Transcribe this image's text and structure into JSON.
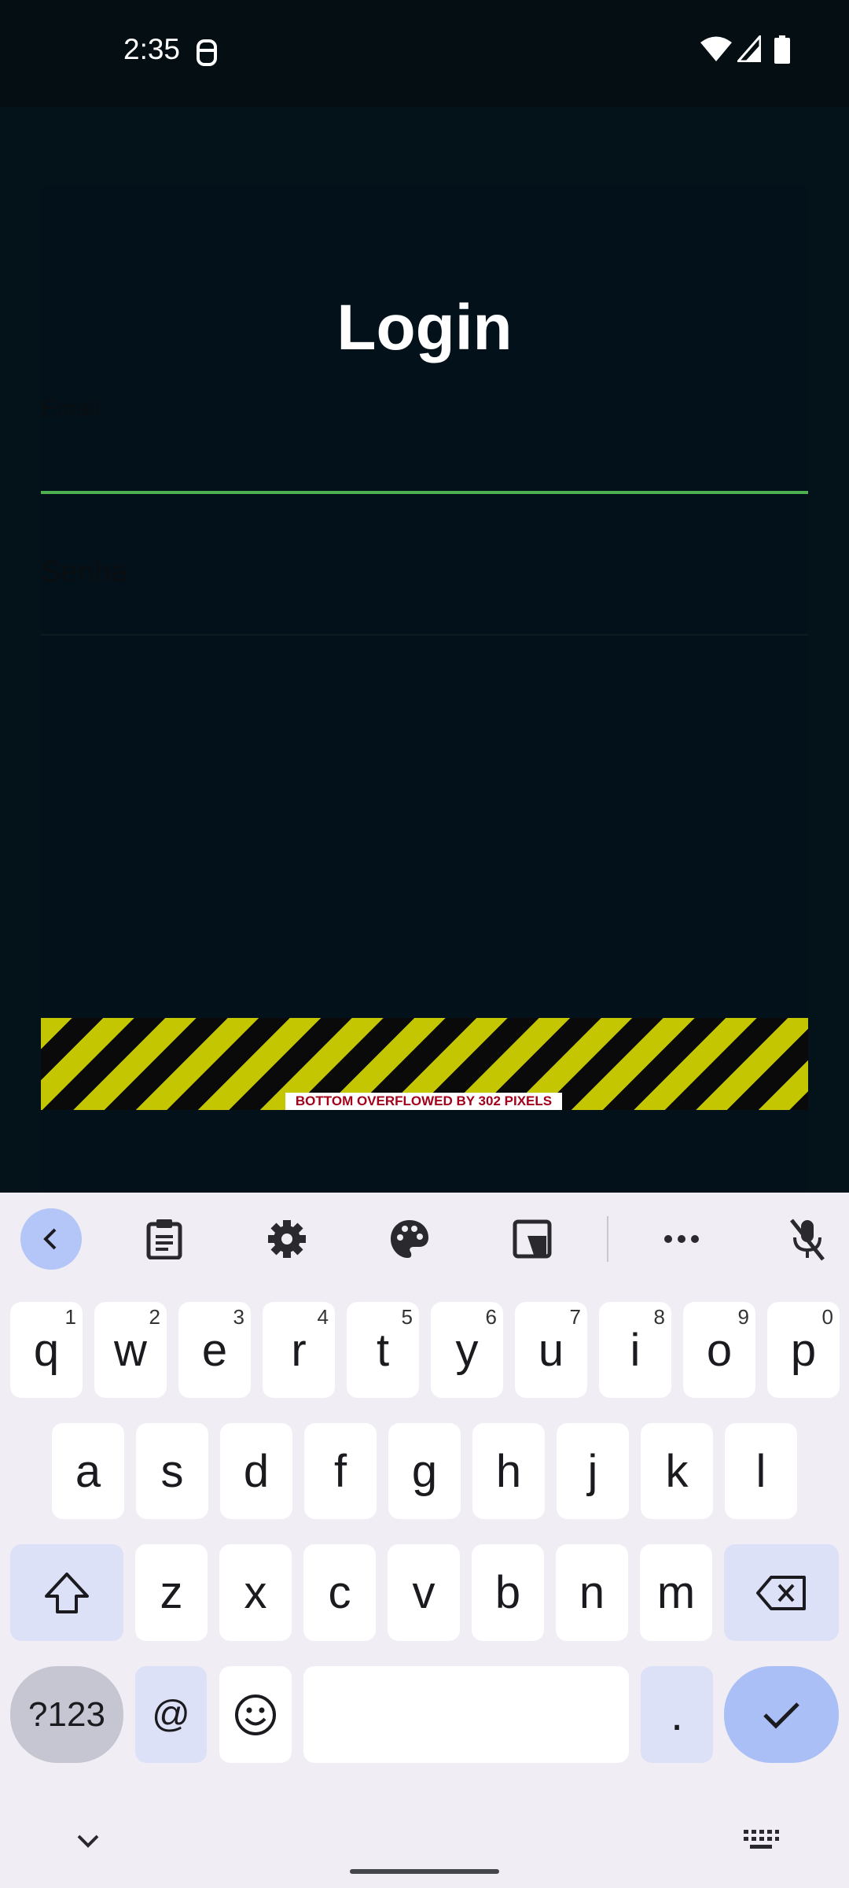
{
  "status_bar": {
    "time": "2:35"
  },
  "login": {
    "title": "Login",
    "email_label": "Email",
    "password_label": "Senha",
    "overflow_warning": "BOTTOM OVERFLOWED BY 302 PIXELS"
  },
  "keyboard": {
    "row1": [
      {
        "key": "q",
        "hint": "1"
      },
      {
        "key": "w",
        "hint": "2"
      },
      {
        "key": "e",
        "hint": "3"
      },
      {
        "key": "r",
        "hint": "4"
      },
      {
        "key": "t",
        "hint": "5"
      },
      {
        "key": "y",
        "hint": "6"
      },
      {
        "key": "u",
        "hint": "7"
      },
      {
        "key": "i",
        "hint": "8"
      },
      {
        "key": "o",
        "hint": "9"
      },
      {
        "key": "p",
        "hint": "0"
      }
    ],
    "row2": [
      "a",
      "s",
      "d",
      "f",
      "g",
      "h",
      "j",
      "k",
      "l"
    ],
    "row3": [
      "z",
      "x",
      "c",
      "v",
      "b",
      "n",
      "m"
    ],
    "symbols_label": "?123",
    "at_label": "@",
    "period_label": "."
  },
  "icons": {
    "back": "chevron-left-icon",
    "clipboard": "clipboard-icon",
    "settings": "gear-icon",
    "theme": "palette-icon",
    "floating": "floating-keyboard-icon",
    "more": "more-dots-icon",
    "mic": "mic-off-icon",
    "shift": "shift-icon",
    "delete": "backspace-icon",
    "emoji": "emoji-icon",
    "enter": "check-icon",
    "hide": "chevron-down-icon",
    "switch": "keyboard-icon"
  },
  "colors": {
    "accent_underline": "#4caf50",
    "overflow_stripe": "#c3c600"
  }
}
